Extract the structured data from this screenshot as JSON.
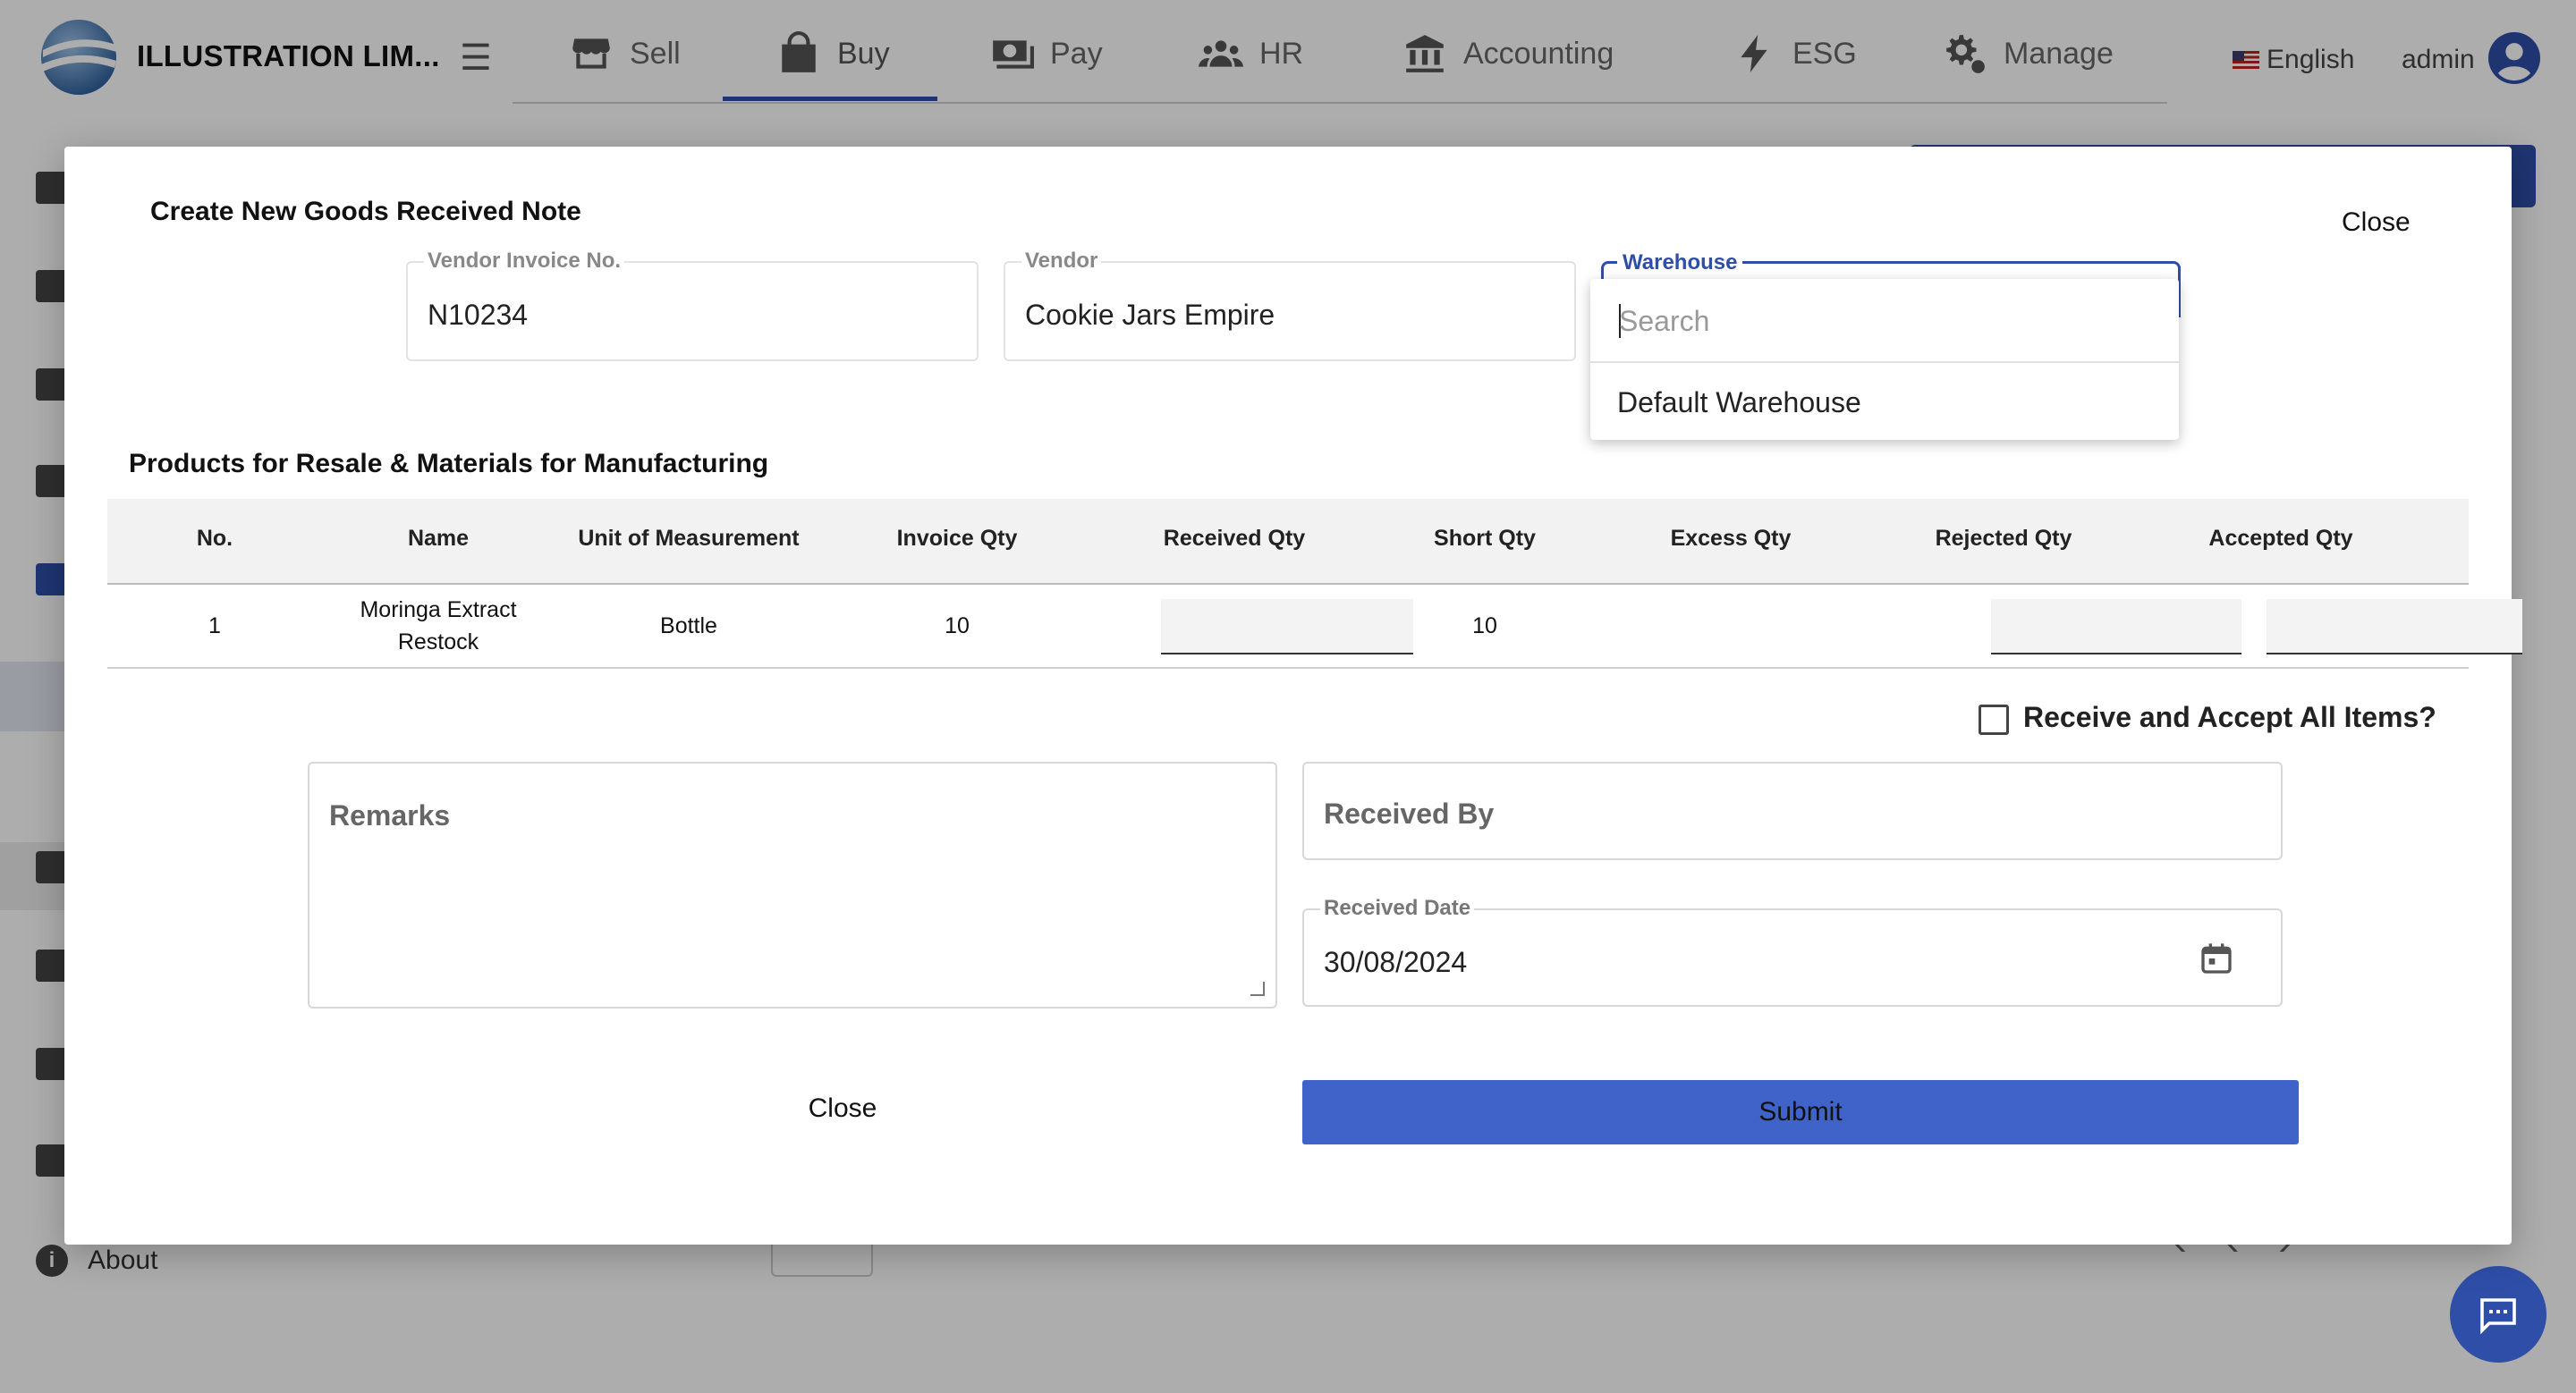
{
  "header": {
    "brand": "ILLUSTRATION LIM...",
    "nav": [
      {
        "label": "Sell",
        "icon": "store-icon"
      },
      {
        "label": "Buy",
        "icon": "shopping-bag-icon"
      },
      {
        "label": "Pay",
        "icon": "cash-icon"
      },
      {
        "label": "HR",
        "icon": "people-icon"
      },
      {
        "label": "Accounting",
        "icon": "bank-icon"
      },
      {
        "label": "ESG",
        "icon": "bolt-icon"
      },
      {
        "label": "Manage",
        "icon": "gears-icon"
      }
    ],
    "active_nav": "Buy",
    "language": "English",
    "user": "admin"
  },
  "sidebar": {
    "about_label": "About"
  },
  "modal": {
    "title": "Create New Goods Received Note",
    "close_top_label": "Close",
    "fields": {
      "vendor_invoice": {
        "label": "Vendor Invoice No.",
        "value": "N10234"
      },
      "vendor": {
        "label": "Vendor",
        "value": "Cookie Jars Empire"
      },
      "warehouse": {
        "label": "Warehouse",
        "search_placeholder": "Search",
        "options": [
          "Default Warehouse"
        ]
      }
    },
    "section_title": "Products for Resale & Materials for Manufacturing",
    "table": {
      "columns": [
        "No.",
        "Name",
        "Unit of Measurement",
        "Invoice Qty",
        "Received Qty",
        "Short Qty",
        "Excess Qty",
        "Rejected Qty",
        "Accepted Qty"
      ],
      "rows": [
        {
          "no": "1",
          "name_line1": "Moringa Extract",
          "name_line2": "Restock",
          "uom": "Bottle",
          "invoice_qty": "10",
          "short_qty": "10",
          "excess_qty": ""
        }
      ]
    },
    "receive_all_label": "Receive and Accept All Items?",
    "remarks_label": "Remarks",
    "received_by_label": "Received By",
    "received_date": {
      "label": "Received Date",
      "value": "30/08/2024"
    },
    "close_button": "Close",
    "submit_button": "Submit"
  },
  "colors": {
    "primary": "#2f4ea8",
    "submit": "#3f63c8"
  }
}
